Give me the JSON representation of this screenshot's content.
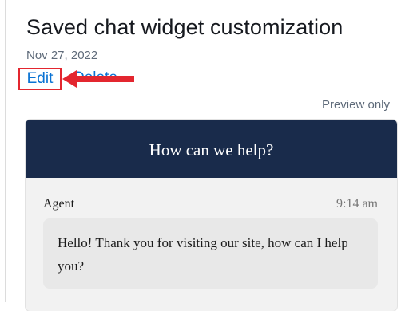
{
  "header": {
    "title": "Saved chat widget customization",
    "date": "Nov 27, 2022"
  },
  "actions": {
    "edit_label": "Edit",
    "delete_label": "Delete"
  },
  "preview": {
    "label": "Preview only"
  },
  "widget": {
    "header_title": "How can we help?",
    "messages": [
      {
        "sender": "Agent",
        "time": "9:14 am",
        "text": "Hello! Thank you for visiting our site, how can I help you?"
      }
    ]
  },
  "colors": {
    "link": "#0972d3",
    "highlight": "#e3262f",
    "widget_header_bg": "#192b4b",
    "bubble_bg": "#e8e8e8"
  }
}
